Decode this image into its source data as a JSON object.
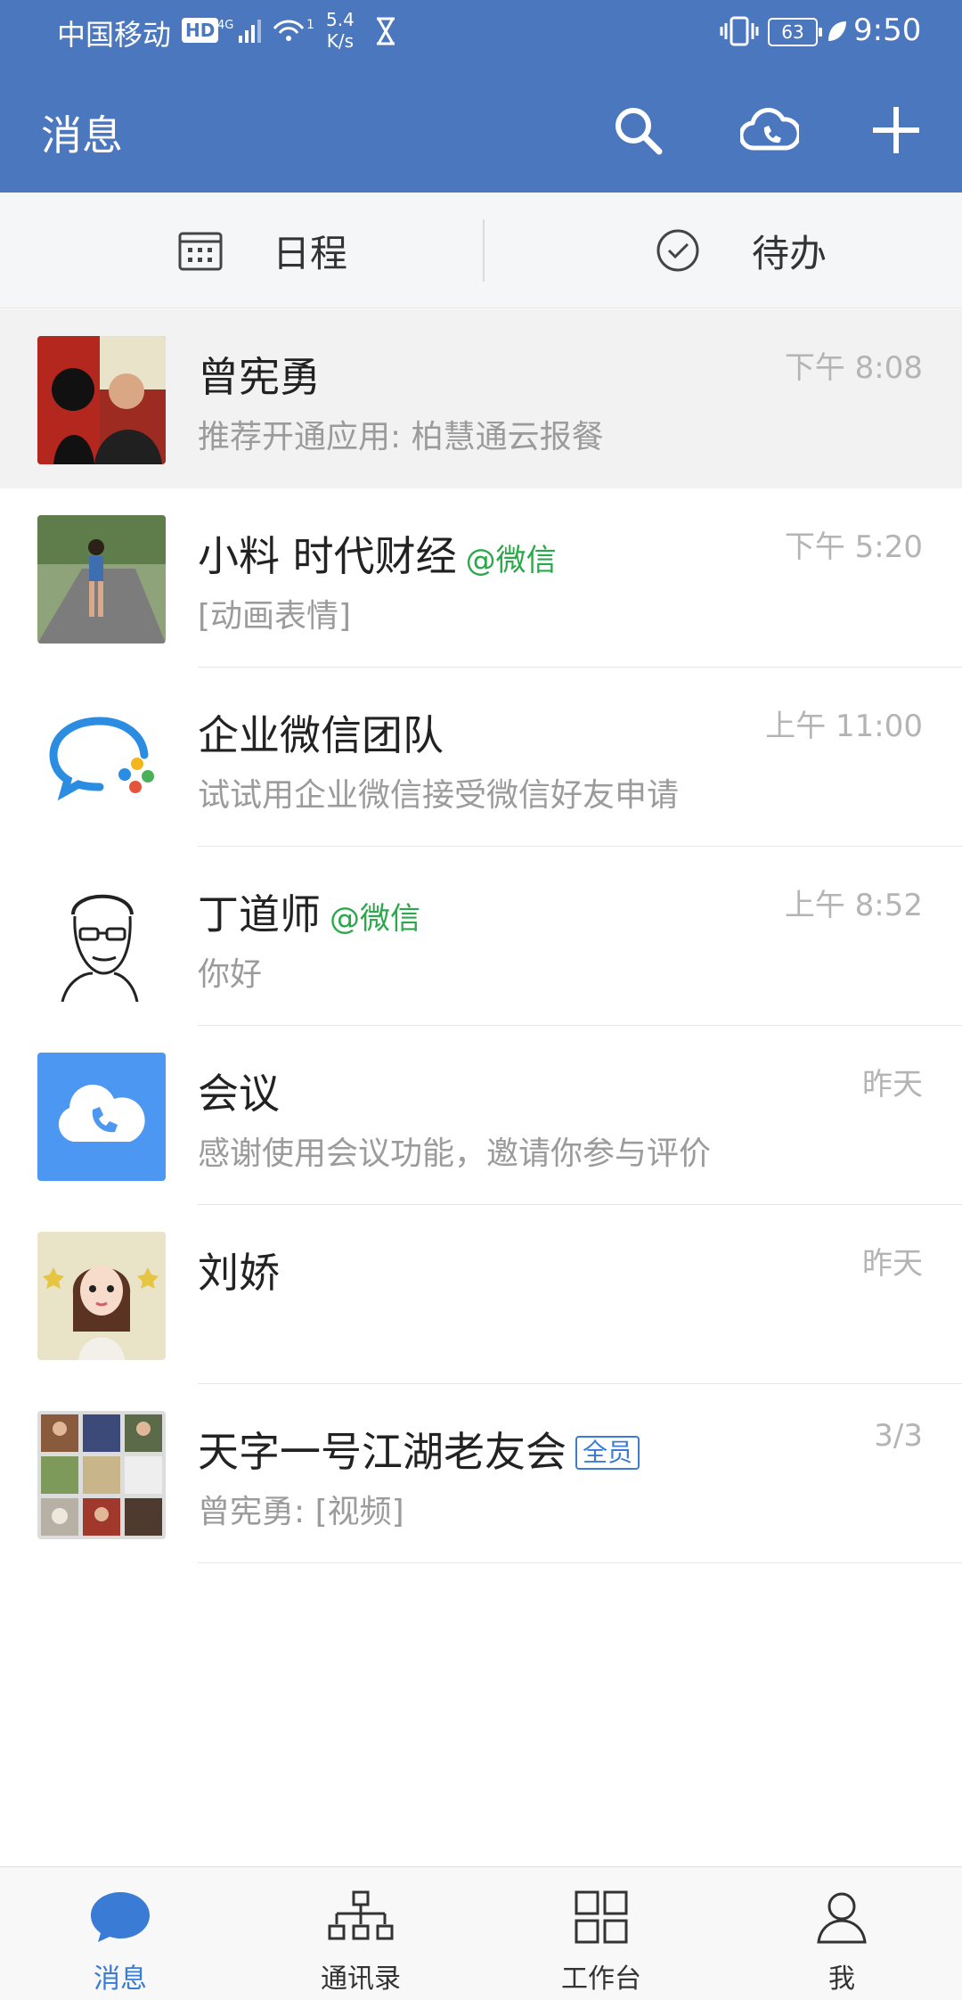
{
  "status_bar": {
    "carrier": "中国移动",
    "hd": "HD",
    "network": "4G",
    "wifi_count": "1",
    "speed_value": "5.4",
    "speed_unit": "K/s",
    "battery": "63",
    "time": "9:50"
  },
  "header": {
    "title": "消息",
    "icons": [
      "search-icon",
      "cloud-phone-icon",
      "plus-icon"
    ]
  },
  "quick_actions": {
    "schedule_label": "日程",
    "todo_label": "待办"
  },
  "conversations": [
    {
      "name": "曾宪勇",
      "tag": "",
      "badge": "",
      "preview": "推荐开通应用: 柏慧通云报餐",
      "time": "下午 8:08"
    },
    {
      "name": "小料 时代财经",
      "tag": "@微信",
      "badge": "",
      "preview": "[动画表情]",
      "time": "下午 5:20"
    },
    {
      "name": "企业微信团队",
      "tag": "",
      "badge": "",
      "preview": "试试用企业微信接受微信好友申请",
      "time": "上午 11:00"
    },
    {
      "name": "丁道师",
      "tag": "@微信",
      "badge": "",
      "preview": "你好",
      "time": "上午 8:52"
    },
    {
      "name": "会议",
      "tag": "",
      "badge": "",
      "preview": "感谢使用会议功能，邀请你参与评价",
      "time": "昨天"
    },
    {
      "name": "刘娇",
      "tag": "",
      "badge": "",
      "preview": "",
      "time": "昨天"
    },
    {
      "name": "天字一号江湖老友会",
      "tag": "",
      "badge": "全员",
      "preview": "曾宪勇: [视频]",
      "time": "3/3"
    }
  ],
  "bottom_nav": {
    "items": [
      {
        "label": "消息",
        "active": true
      },
      {
        "label": "通讯录",
        "active": false
      },
      {
        "label": "工作台",
        "active": false
      },
      {
        "label": "我",
        "active": false
      }
    ]
  },
  "colors": {
    "header_bg": "#4a77bd",
    "accent": "#3a7bd5",
    "wechat_tag": "#2aa84a"
  }
}
